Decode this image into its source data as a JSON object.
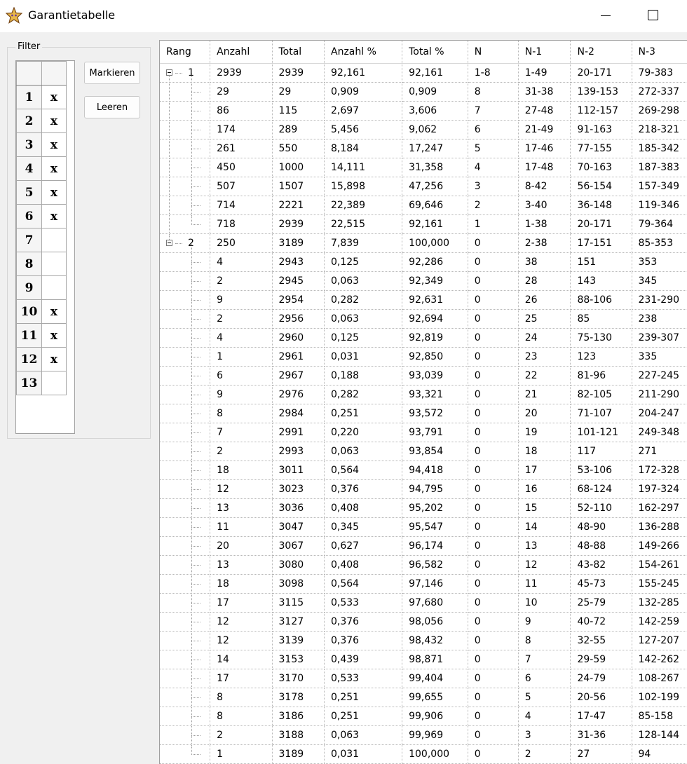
{
  "window": {
    "title": "Garantietabelle",
    "icon": "star-icon"
  },
  "filter": {
    "legend": "Filter",
    "rows": [
      {
        "num": "1",
        "mark": "x"
      },
      {
        "num": "2",
        "mark": "x"
      },
      {
        "num": "3",
        "mark": "x"
      },
      {
        "num": "4",
        "mark": "x"
      },
      {
        "num": "5",
        "mark": "x"
      },
      {
        "num": "6",
        "mark": "x"
      },
      {
        "num": "7",
        "mark": ""
      },
      {
        "num": "8",
        "mark": ""
      },
      {
        "num": "9",
        "mark": ""
      },
      {
        "num": "10",
        "mark": "x"
      },
      {
        "num": "11",
        "mark": "x"
      },
      {
        "num": "12",
        "mark": "x"
      },
      {
        "num": "13",
        "mark": ""
      }
    ],
    "mark_button": "Markieren",
    "clear_button": "Leeren"
  },
  "table": {
    "columns": [
      "Rang",
      "Anzahl",
      "Total",
      "Anzahl %",
      "Total %",
      "N",
      "N-1",
      "N-2",
      "N-3"
    ],
    "rows": [
      {
        "group": true,
        "rang": "1",
        "cells": [
          "2939",
          "2939",
          "92,161",
          "92,161",
          "1-8",
          "1-49",
          "20-171",
          "79-383"
        ]
      },
      {
        "cells": [
          "29",
          "29",
          "0,909",
          "0,909",
          "8",
          "31-38",
          "139-153",
          "272-337"
        ]
      },
      {
        "cells": [
          "86",
          "115",
          "2,697",
          "3,606",
          "7",
          "27-48",
          "112-157",
          "269-298"
        ]
      },
      {
        "cells": [
          "174",
          "289",
          "5,456",
          "9,062",
          "6",
          "21-49",
          "91-163",
          "218-321"
        ]
      },
      {
        "cells": [
          "261",
          "550",
          "8,184",
          "17,247",
          "5",
          "17-46",
          "77-155",
          "185-342"
        ]
      },
      {
        "cells": [
          "450",
          "1000",
          "14,111",
          "31,358",
          "4",
          "17-48",
          "70-163",
          "187-383"
        ]
      },
      {
        "cells": [
          "507",
          "1507",
          "15,898",
          "47,256",
          "3",
          "8-42",
          "56-154",
          "157-349"
        ]
      },
      {
        "cells": [
          "714",
          "2221",
          "22,389",
          "69,646",
          "2",
          "3-40",
          "36-148",
          "119-346"
        ]
      },
      {
        "last": true,
        "cells": [
          "718",
          "2939",
          "22,515",
          "92,161",
          "1",
          "1-38",
          "20-171",
          "79-364"
        ]
      },
      {
        "group": true,
        "rang": "2",
        "cells": [
          "250",
          "3189",
          "7,839",
          "100,000",
          "0",
          "2-38",
          "17-151",
          "85-353"
        ]
      },
      {
        "cells": [
          "4",
          "2943",
          "0,125",
          "92,286",
          "0",
          "38",
          "151",
          "353"
        ]
      },
      {
        "cells": [
          "2",
          "2945",
          "0,063",
          "92,349",
          "0",
          "28",
          "143",
          "345"
        ]
      },
      {
        "cells": [
          "9",
          "2954",
          "0,282",
          "92,631",
          "0",
          "26",
          "88-106",
          "231-290"
        ]
      },
      {
        "cells": [
          "2",
          "2956",
          "0,063",
          "92,694",
          "0",
          "25",
          "85",
          "238"
        ]
      },
      {
        "cells": [
          "4",
          "2960",
          "0,125",
          "92,819",
          "0",
          "24",
          "75-130",
          "239-307"
        ]
      },
      {
        "cells": [
          "1",
          "2961",
          "0,031",
          "92,850",
          "0",
          "23",
          "123",
          "335"
        ]
      },
      {
        "cells": [
          "6",
          "2967",
          "0,188",
          "93,039",
          "0",
          "22",
          "81-96",
          "227-245"
        ]
      },
      {
        "cells": [
          "9",
          "2976",
          "0,282",
          "93,321",
          "0",
          "21",
          "82-105",
          "211-290"
        ]
      },
      {
        "cells": [
          "8",
          "2984",
          "0,251",
          "93,572",
          "0",
          "20",
          "71-107",
          "204-247"
        ]
      },
      {
        "cells": [
          "7",
          "2991",
          "0,220",
          "93,791",
          "0",
          "19",
          "101-121",
          "249-348"
        ]
      },
      {
        "cells": [
          "2",
          "2993",
          "0,063",
          "93,854",
          "0",
          "18",
          "117",
          "271"
        ]
      },
      {
        "cells": [
          "18",
          "3011",
          "0,564",
          "94,418",
          "0",
          "17",
          "53-106",
          "172-328"
        ]
      },
      {
        "cells": [
          "12",
          "3023",
          "0,376",
          "94,795",
          "0",
          "16",
          "68-124",
          "197-324"
        ]
      },
      {
        "cells": [
          "13",
          "3036",
          "0,408",
          "95,202",
          "0",
          "15",
          "52-110",
          "162-297"
        ]
      },
      {
        "cells": [
          "11",
          "3047",
          "0,345",
          "95,547",
          "0",
          "14",
          "48-90",
          "136-288"
        ]
      },
      {
        "cells": [
          "20",
          "3067",
          "0,627",
          "96,174",
          "0",
          "13",
          "48-88",
          "149-266"
        ]
      },
      {
        "cells": [
          "13",
          "3080",
          "0,408",
          "96,582",
          "0",
          "12",
          "43-82",
          "154-261"
        ]
      },
      {
        "cells": [
          "18",
          "3098",
          "0,564",
          "97,146",
          "0",
          "11",
          "45-73",
          "155-245"
        ]
      },
      {
        "cells": [
          "17",
          "3115",
          "0,533",
          "97,680",
          "0",
          "10",
          "25-79",
          "132-285"
        ]
      },
      {
        "cells": [
          "12",
          "3127",
          "0,376",
          "98,056",
          "0",
          "9",
          "40-72",
          "142-259"
        ]
      },
      {
        "cells": [
          "12",
          "3139",
          "0,376",
          "98,432",
          "0",
          "8",
          "32-55",
          "127-207"
        ]
      },
      {
        "cells": [
          "14",
          "3153",
          "0,439",
          "98,871",
          "0",
          "7",
          "29-59",
          "142-262"
        ]
      },
      {
        "cells": [
          "17",
          "3170",
          "0,533",
          "99,404",
          "0",
          "6",
          "24-79",
          "108-267"
        ]
      },
      {
        "cells": [
          "8",
          "3178",
          "0,251",
          "99,655",
          "0",
          "5",
          "20-56",
          "102-199"
        ]
      },
      {
        "cells": [
          "8",
          "3186",
          "0,251",
          "99,906",
          "0",
          "4",
          "17-47",
          "85-158"
        ]
      },
      {
        "cells": [
          "2",
          "3188",
          "0,063",
          "99,969",
          "0",
          "3",
          "31-36",
          "128-144"
        ]
      },
      {
        "last": true,
        "cells": [
          "1",
          "3189",
          "0,031",
          "100,000",
          "0",
          "2",
          "27",
          "94"
        ]
      }
    ]
  }
}
